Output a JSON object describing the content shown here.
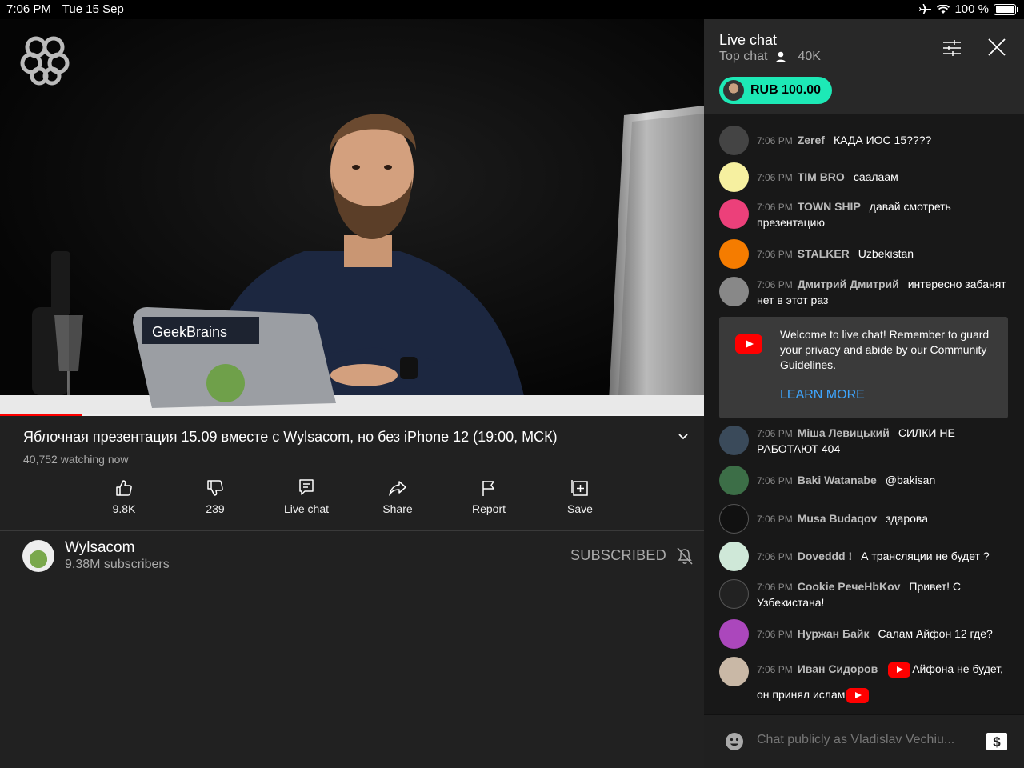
{
  "status_bar": {
    "time": "7:06 PM",
    "date": "Tue 15 Sep",
    "battery": "100 %",
    "battery_level": 1.0
  },
  "video": {
    "progress": 0.117,
    "title": "Яблочная презентация 15.09 вместе с Wylsacom, но без iPhone 12 (19:00, МСК)",
    "watching": "40,752 watching now",
    "laptop_sticker": "GeekBrains",
    "actions": [
      {
        "icon": "thumbs-up-icon",
        "label": "9.8K"
      },
      {
        "icon": "thumbs-down-icon",
        "label": "239"
      },
      {
        "icon": "live-chat-icon",
        "label": "Live chat"
      },
      {
        "icon": "share-icon",
        "label": "Share"
      },
      {
        "icon": "flag-icon",
        "label": "Report"
      },
      {
        "icon": "save-playlist-icon",
        "label": "Save"
      }
    ]
  },
  "channel": {
    "name": "Wylsacom",
    "subscribers": "9.38M subscribers",
    "subscribe_label": "SUBSCRIBED"
  },
  "chat": {
    "title": "Live chat",
    "mode": "Top chat",
    "viewers": "40K",
    "superchat_amount": "RUB 100.00",
    "superchat_color": "#1de9b6",
    "messages_top": [
      {
        "time": "7:06 PM",
        "author": "Zeref",
        "text": "КАДА ИОС 15????",
        "avatar_color": "#444"
      },
      {
        "time": "7:06 PM",
        "author": "TIM BRO",
        "text": "саалаам",
        "avatar_color": "#f6f0a0"
      },
      {
        "time": "7:06 PM",
        "author": "TOWN SHIP",
        "text": "давай смотреть презентацию",
        "avatar_color": "#ec407a"
      },
      {
        "time": "7:06 PM",
        "author": "STALKER",
        "text": "Uzbekistan",
        "avatar_color": "#f57c00"
      },
      {
        "time": "7:06 PM",
        "author": "Дмитрий Дмитрий",
        "text": "интересно забанят нет в этот раз",
        "avatar_color": "#888"
      }
    ],
    "welcome": {
      "text": "Welcome to live chat! Remember to guard your privacy and abide by our Community Guidelines.",
      "link": "LEARN MORE"
    },
    "messages_bottom": [
      {
        "time": "7:06 PM",
        "author": "Міша Левицький",
        "text": "СИЛКИ НЕ РАБОТАЮТ 404",
        "avatar_color": "#3a4a5a"
      },
      {
        "time": "7:06 PM",
        "author": "Baki Watanabe",
        "text": "@bakisan",
        "avatar_color": "#3c6e47"
      },
      {
        "time": "7:06 PM",
        "author": "Musa Budaqov",
        "text": "здарова",
        "avatar_color": "#111"
      },
      {
        "time": "7:06 PM",
        "author": "Doveddd !",
        "text": "А трансляции не будет ?",
        "avatar_color": "#cfe8d8"
      },
      {
        "time": "7:06 PM",
        "author": "Cookie PeчeHbKov",
        "text": "Привет! С Узбекистана!",
        "avatar_color": "#222"
      },
      {
        "time": "7:06 PM",
        "author": "Нуржан Байк",
        "text": "Салам Айфон 12 где?",
        "avatar_color": "#ab47bc"
      },
      {
        "time": "7:06 PM",
        "author": "Иван Сидоров",
        "text": "Айфона не будет, он принял ислам",
        "avatar_color": "#c9b8a6"
      }
    ],
    "input_placeholder": "Chat publicly as Vladislav Vechiu..."
  }
}
